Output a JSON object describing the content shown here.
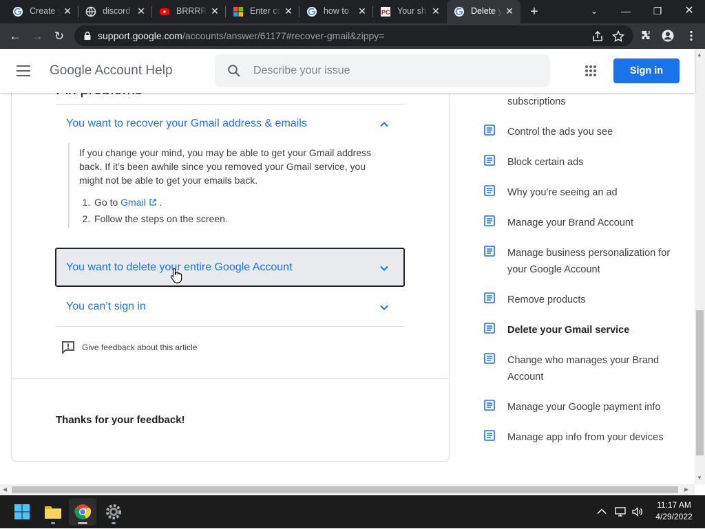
{
  "browser": {
    "tabs": [
      {
        "title": "Create y",
        "favicon": "google-icon"
      },
      {
        "title": "discord",
        "favicon": "globe-icon"
      },
      {
        "title": "BRRRRR",
        "favicon": "youtube-icon"
      },
      {
        "title": "Enter co",
        "favicon": "microsoft-icon"
      },
      {
        "title": "how to",
        "favicon": "google-icon"
      },
      {
        "title": "Your sh",
        "favicon": "pcm-icon"
      },
      {
        "title": "Delete y",
        "favicon": "google-icon",
        "active": true
      }
    ],
    "url_host": "support.google.com",
    "url_path": "/accounts/answer/61177#recover-gmail&zippy="
  },
  "header": {
    "title": "Google Account Help",
    "search_placeholder": "Describe your issue",
    "signin_label": "Sign in"
  },
  "article": {
    "section_heading": "Fix problems",
    "accordions": [
      {
        "title": "You want to recover your Gmail address & emails",
        "expanded": true
      },
      {
        "title": "You want to delete your entire Google Account",
        "expanded": false,
        "focused": true
      },
      {
        "title": "You can’t sign in",
        "expanded": false
      }
    ],
    "body_text": "If you change your mind, you may be able to get your Gmail address back. If it’s been awhile since you removed your Gmail service, you might not be able to get your emails back.",
    "steps": {
      "step1_prefix": "Go to",
      "step1_link": "Gmail",
      "step1_suffix": ".",
      "step2": "Follow the steps on the screen."
    },
    "feedback_label": "Give feedback about this article",
    "thanks": "Thanks for your feedback!"
  },
  "sidebar": {
    "items": [
      {
        "label": "subscriptions",
        "partial": true
      },
      {
        "label": "Control the ads you see"
      },
      {
        "label": "Block certain ads"
      },
      {
        "label": "Why you’re seeing an ad"
      },
      {
        "label": "Manage your Brand Account"
      },
      {
        "label": "Manage business personalization for your Google Account"
      },
      {
        "label": "Remove products"
      },
      {
        "label": "Delete your Gmail service",
        "current": true
      },
      {
        "label": "Change who manages your Brand Account"
      },
      {
        "label": "Manage your Google payment info"
      },
      {
        "label": "Manage app info from your devices"
      }
    ]
  },
  "taskbar": {
    "time": "11:17 AM",
    "date": "4/29/2022",
    "apps": [
      "windows-start-icon",
      "file-explorer-icon",
      "chrome-icon",
      "settings-icon"
    ]
  },
  "colors": {
    "link_blue": "#1a73e8",
    "tab_bar": "#202124",
    "toolbar": "#35363a"
  }
}
